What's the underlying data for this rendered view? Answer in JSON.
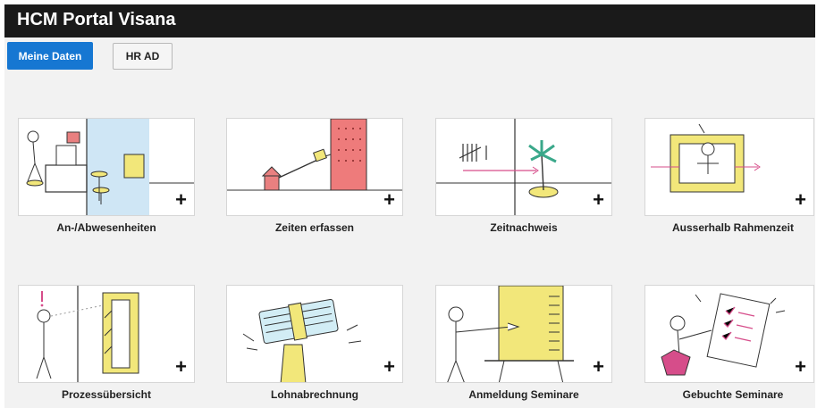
{
  "header": {
    "title": "HCM Portal Visana",
    "bg": "#1a1a1a"
  },
  "tabs": [
    {
      "label": "Meine Daten",
      "active": true,
      "color": "#1677d2"
    },
    {
      "label": "HR AD",
      "active": false
    }
  ],
  "tiles": [
    {
      "label": "An-/Abwesenheiten",
      "action": "+",
      "icon": "office-desk-illustration"
    },
    {
      "label": "Zeiten erfassen",
      "action": "+",
      "icon": "house-to-building-illustration"
    },
    {
      "label": "Zeitnachweis",
      "action": "+",
      "icon": "tally-palm-island-illustration"
    },
    {
      "label": "Ausserhalb Rahmenzeit",
      "action": "+",
      "icon": "person-in-frame-illustration"
    },
    {
      "label": "Prozessübersicht",
      "action": "+",
      "icon": "traffic-light-illustration"
    },
    {
      "label": "Lohnabrechnung",
      "action": "+",
      "icon": "money-stack-illustration"
    },
    {
      "label": "Anmeldung Seminare",
      "action": "+",
      "icon": "presentation-board-illustration"
    },
    {
      "label": "Gebuchte Seminare",
      "action": "+",
      "icon": "checklist-illustration"
    }
  ]
}
